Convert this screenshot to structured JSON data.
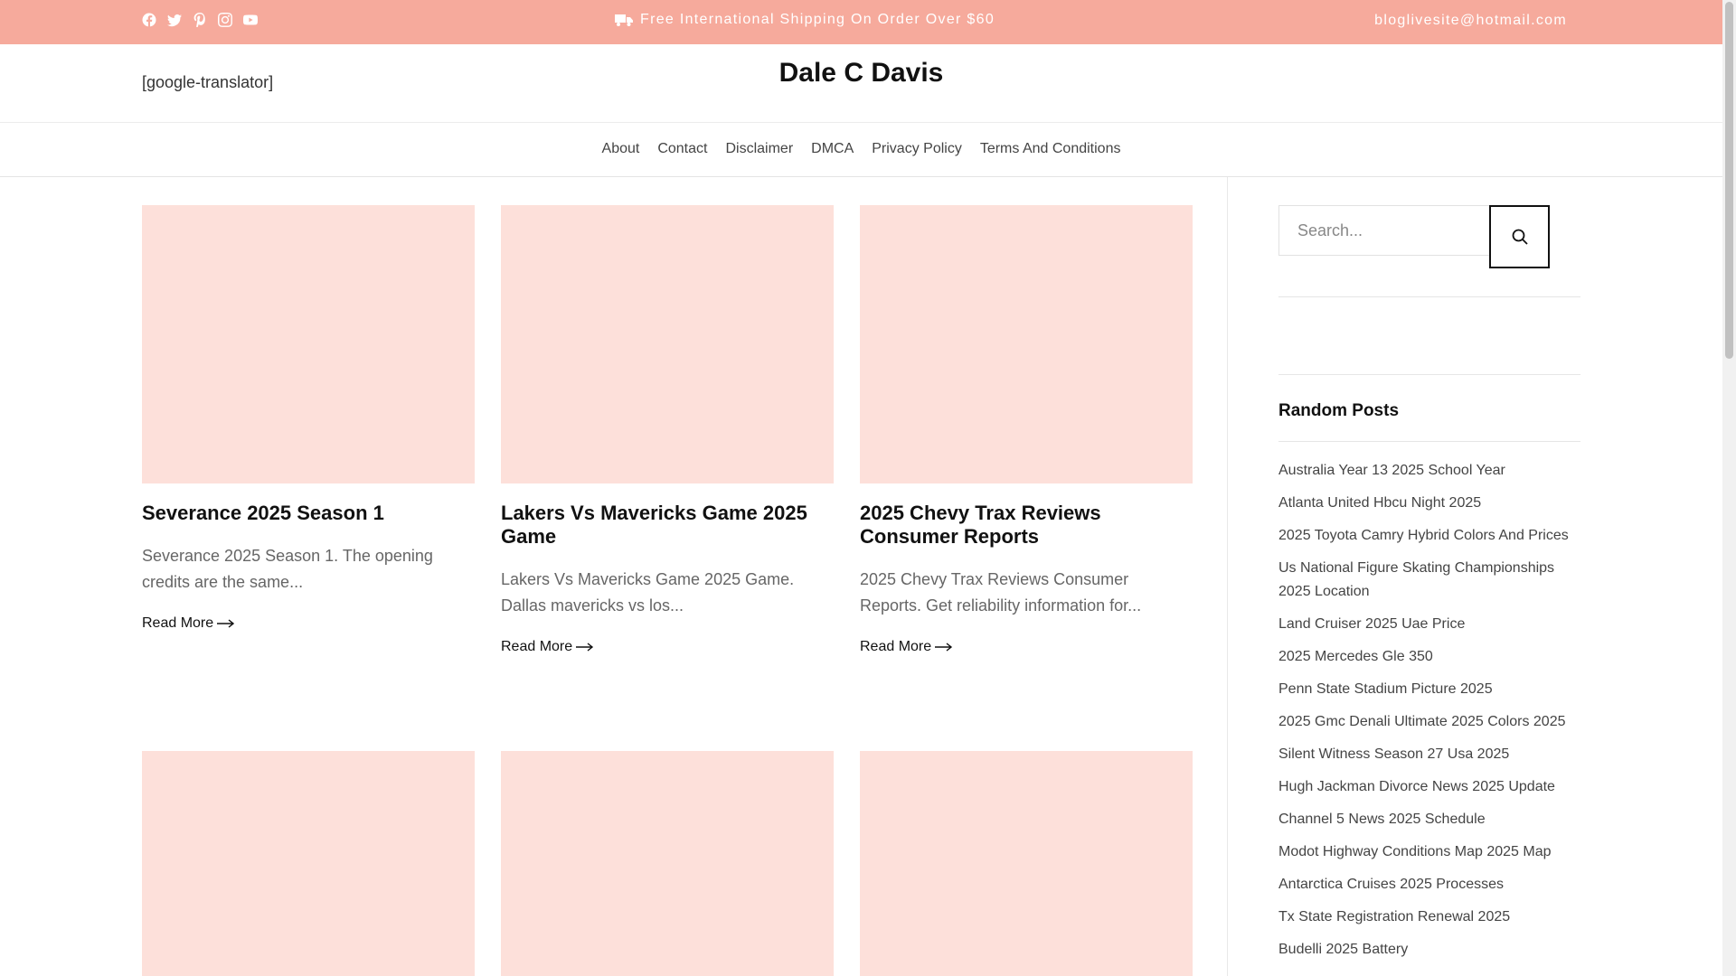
{
  "topbar": {
    "social": [
      "facebook-icon",
      "twitter-icon",
      "pinterest-icon",
      "instagram-icon",
      "youtube-icon"
    ],
    "promo": "Free International Shipping On Order Over $60",
    "email": "bloglivesite@hotmail.com"
  },
  "header": {
    "translator": "[google-translator]",
    "site_title": "Dale C Davis"
  },
  "nav": [
    "About",
    "Contact",
    "Disclaimer",
    "DMCA",
    "Privacy Policy",
    "Terms And Conditions"
  ],
  "posts": [
    {
      "title": "Severance 2025 Season 1",
      "excerpt": "Severance 2025 Season 1. The opening credits are the same...",
      "read_more": "Read More"
    },
    {
      "title": "Lakers Vs Mavericks Game 2025 Game",
      "excerpt": "Lakers Vs Mavericks Game 2025 Game. Dallas mavericks vs los...",
      "read_more": "Read More"
    },
    {
      "title": "2025 Chevy Trax Reviews Consumer Reports",
      "excerpt": "2025 Chevy Trax Reviews Consumer Reports. Get reliability information for...",
      "read_more": "Read More"
    }
  ],
  "sidebar": {
    "search_placeholder": "Search...",
    "random_posts_title": "Random Posts",
    "random_posts": [
      "Australia Year 13 2025 School Year",
      "Atlanta United Hbcu Night 2025",
      "2025 Toyota Camry Hybrid Colors And Prices",
      "Us National Figure Skating Championships 2025 Location",
      "Land Cruiser 2025 Uae Price",
      "2025 Mercedes Gle 350",
      "Penn State Stadium Picture 2025",
      "2025 Gmc Denali Ultimate 2025 Colors 2025",
      "Silent Witness Season 27 Usa 2025",
      "Hugh Jackman Divorce News 2025 Update",
      "Channel 5 News 2025 Schedule",
      "Modot Highway Conditions Map 2025 Map",
      "Antarctica Cruises 2025 Processes",
      "Tx State Registration Renewal 2025",
      "Budelli 2025 Battery"
    ]
  },
  "colors": {
    "topbar": "#f6aa9c",
    "thumbnail": "#fde0da"
  }
}
